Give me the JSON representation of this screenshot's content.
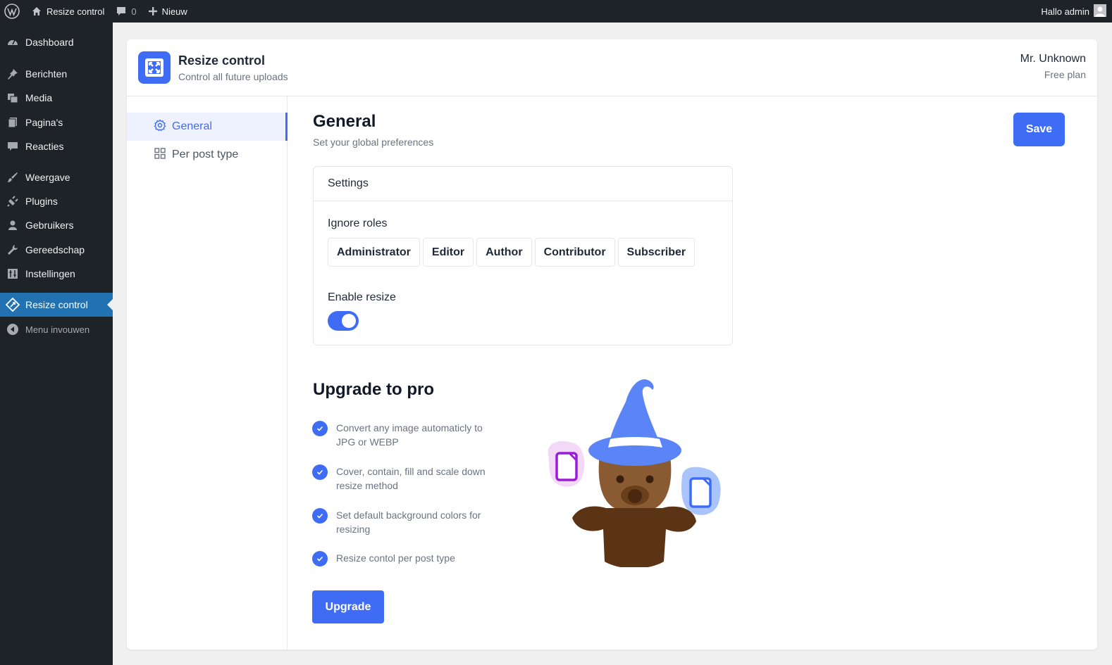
{
  "adminbar": {
    "site_name": "Resize control",
    "comments_count": "0",
    "new_label": "Nieuw",
    "greeting": "Hallo admin"
  },
  "sidebar": {
    "items": [
      {
        "label": "Dashboard",
        "icon": "dashboard-icon"
      },
      {
        "label": "Berichten",
        "icon": "pin-icon"
      },
      {
        "label": "Media",
        "icon": "media-icon"
      },
      {
        "label": "Pagina's",
        "icon": "pages-icon"
      },
      {
        "label": "Reacties",
        "icon": "comments-icon"
      },
      {
        "label": "Weergave",
        "icon": "brush-icon"
      },
      {
        "label": "Plugins",
        "icon": "plugin-icon"
      },
      {
        "label": "Gebruikers",
        "icon": "user-icon"
      },
      {
        "label": "Gereedschap",
        "icon": "wrench-icon"
      },
      {
        "label": "Instellingen",
        "icon": "settings-icon"
      },
      {
        "label": "Resize control",
        "icon": "resize-icon",
        "active": true
      },
      {
        "label": "Menu invouwen",
        "icon": "collapse-icon"
      }
    ]
  },
  "app": {
    "title": "Resize control",
    "subtitle": "Control all future uploads",
    "user_name": "Mr. Unknown",
    "user_plan": "Free plan"
  },
  "subnav": {
    "items": [
      {
        "label": "General",
        "active": true
      },
      {
        "label": "Per post type"
      }
    ]
  },
  "general": {
    "title": "General",
    "subtitle": "Set your global preferences",
    "save_label": "Save"
  },
  "settings": {
    "header": "Settings",
    "ignore_roles_label": "Ignore roles",
    "roles": [
      "Administrator",
      "Editor",
      "Author",
      "Contributor",
      "Subscriber"
    ],
    "enable_resize_label": "Enable resize",
    "enable_resize": true
  },
  "upgrade": {
    "title": "Upgrade to pro",
    "features": [
      "Convert any image automaticly to JPG or WEBP",
      "Cover, contain, fill and scale down resize method",
      "Set default background colors for resizing",
      "Resize contol per post type"
    ],
    "button_label": "Upgrade"
  },
  "colors": {
    "accent": "#3f6cf5",
    "wp_dark": "#1d2327",
    "wp_active": "#2271b1"
  }
}
